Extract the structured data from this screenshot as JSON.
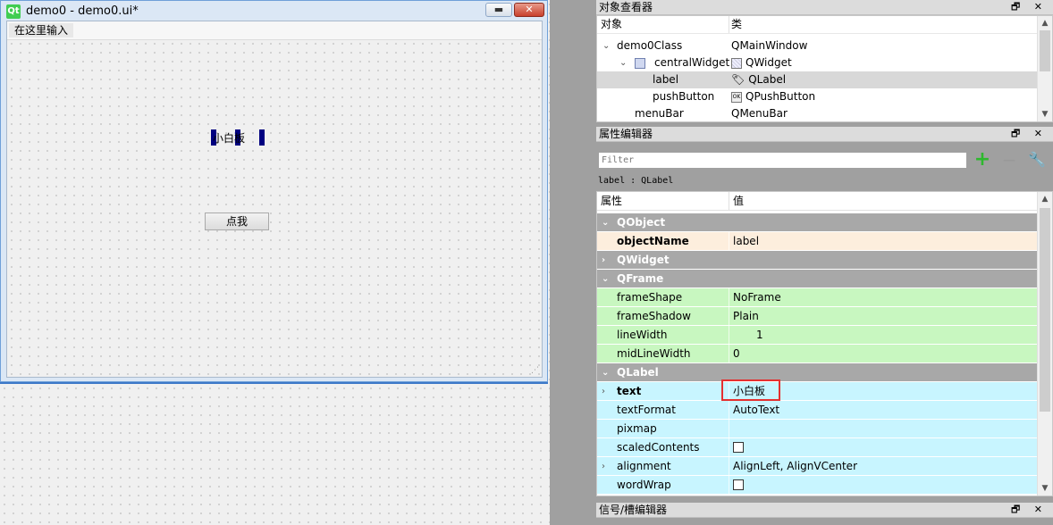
{
  "form_window": {
    "logo": "Qt",
    "title": "demo0 - demo0.ui*",
    "minimize_icon": "minimize-icon",
    "close_icon": "close-icon",
    "menu_placeholder": "在这里输入",
    "label_text": "小白板",
    "button_text": "点我"
  },
  "object_inspector": {
    "title": "对象查看器",
    "col_object": "对象",
    "col_class": "类",
    "rows": [
      {
        "name": "demo0Class",
        "class": "QMainWindow"
      },
      {
        "name": "centralWidget",
        "class": "QWidget"
      },
      {
        "name": "label",
        "class": "QLabel"
      },
      {
        "name": "pushButton",
        "class": "QPushButton"
      },
      {
        "name": "menuBar",
        "class": "QMenuBar"
      }
    ]
  },
  "property_editor": {
    "title": "属性编辑器",
    "filter_placeholder": "Filter",
    "context": "label : QLabel",
    "col_property": "属性",
    "col_value": "值",
    "groups": {
      "qobject": "QObject",
      "qwidget": "QWidget",
      "qframe": "QFrame",
      "qlabel": "QLabel"
    },
    "props": {
      "objectName": {
        "name": "objectName",
        "value": "label"
      },
      "frameShape": {
        "name": "frameShape",
        "value": "NoFrame"
      },
      "frameShadow": {
        "name": "frameShadow",
        "value": "Plain"
      },
      "lineWidth": {
        "name": "lineWidth",
        "value": "1"
      },
      "midLineWidth": {
        "name": "midLineWidth",
        "value": "0"
      },
      "text": {
        "name": "text",
        "value": "小白板"
      },
      "textFormat": {
        "name": "textFormat",
        "value": "AutoText"
      },
      "pixmap": {
        "name": "pixmap",
        "value": ""
      },
      "scaledContents": {
        "name": "scaledContents",
        "value": ""
      },
      "alignment": {
        "name": "alignment",
        "value": "AlignLeft, AlignVCenter"
      },
      "wordWrap": {
        "name": "wordWrap",
        "value": ""
      }
    }
  },
  "signal_slot_editor": {
    "title": "信号/槽编辑器"
  },
  "dock_controls": "🗗 ✕",
  "colors": {
    "group_header": "#a8a8a8",
    "qobject_row": "#fdeedd",
    "qframe_row": "#c8f7c0",
    "qlabel_row": "#c8f5ff",
    "highlight": "#e53030",
    "selection_handle": "#000080"
  }
}
